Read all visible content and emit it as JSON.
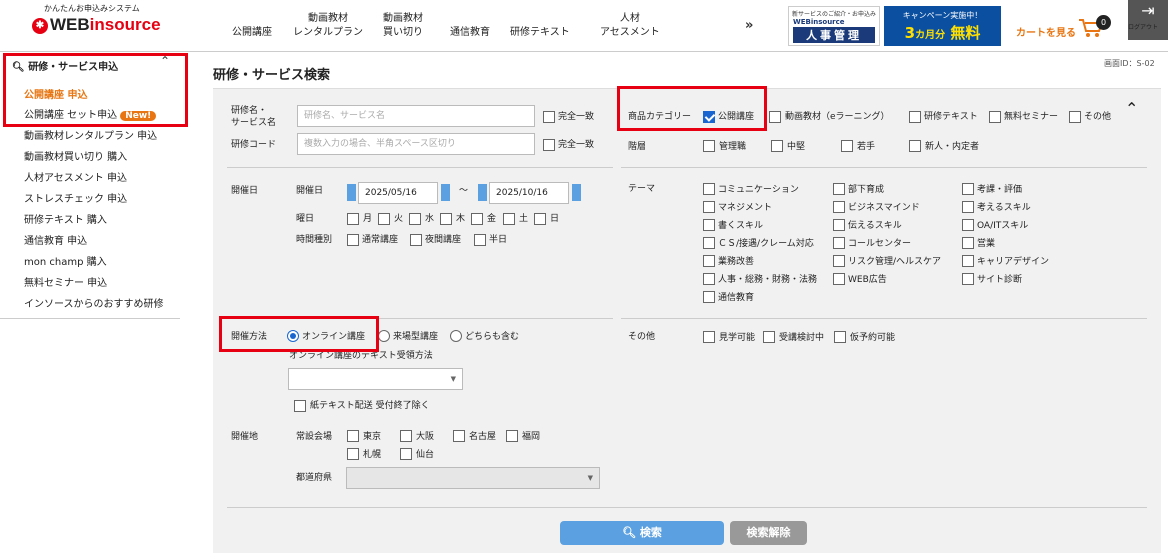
{
  "header": {
    "logo_tagline": "かんたんお申込みシステム",
    "logo_prefix": "WEB",
    "logo_suffix": "insource",
    "nav": [
      {
        "line1": "公開講座",
        "line2": ""
      },
      {
        "line1": "動画教材",
        "line2": "レンタルプラン"
      },
      {
        "line1": "動画教材",
        "line2": "買い切り"
      },
      {
        "line1": "通信教育",
        "line2": ""
      },
      {
        "line1": "研修テキスト",
        "line2": ""
      },
      {
        "line1": "人材",
        "line2": "アセスメント"
      }
    ],
    "more": "»",
    "promo1": {
      "top": "新サービスのご紹介・お申込み",
      "brand": "WEBinsource",
      "main": "人事管理"
    },
    "promo2": {
      "top": "キャンペーン実施中！",
      "main": "3",
      "unit": "カ月分",
      "tail": "無料"
    },
    "cart_label": "カートを見る",
    "cart_count": "0",
    "logout_label": "ログアウト"
  },
  "sidebar": {
    "heading": "研修・サービス申込",
    "items": [
      {
        "label": "公開講座 申込",
        "active": true
      },
      {
        "label": "公開講座 セット申込",
        "badge": "New!"
      },
      {
        "label": "動画教材レンタルプラン 申込"
      },
      {
        "label": "動画教材買い切り 購入"
      },
      {
        "label": "人材アセスメント 申込"
      },
      {
        "label": "ストレスチェック 申込"
      },
      {
        "label": "研修テキスト 購入"
      },
      {
        "label": "通信教育 申込"
      },
      {
        "label": "mon champ 購入"
      },
      {
        "label": "無料セミナー 申込"
      },
      {
        "label": "インソースからのおすすめ研修"
      }
    ]
  },
  "page": {
    "title": "研修・サービス検索",
    "screen_id": "画面ID：S-02"
  },
  "form": {
    "name_label_1": "研修名・",
    "name_label_2": "サービス名",
    "name_placeholder": "研修名、サービス名",
    "exact_label": "完全一致",
    "code_label": "研修コード",
    "code_placeholder": "複数入力の場合、半角スペース区切り",
    "date_section": "開催日",
    "date_label": "開催日",
    "date_from": "2025/05/16",
    "date_tilde": "〜",
    "date_to": "2025/10/16",
    "weekday_label": "曜日",
    "weekdays": [
      "月",
      "火",
      "水",
      "木",
      "金",
      "土",
      "日"
    ],
    "time_label": "時間種別",
    "time_types": [
      "通常講座",
      "夜間講座",
      "半日"
    ],
    "method_label": "開催方法",
    "methods": [
      {
        "label": "オンライン講座",
        "selected": true
      },
      {
        "label": "来場型講座",
        "selected": false
      },
      {
        "label": "どちらも含む",
        "selected": false
      }
    ],
    "text_receipt_label": "オンライン講座のテキスト受領方法",
    "paper_text_label": "紙テキスト配送 受付終了除く",
    "venue_label": "開催地",
    "permanent_venue_label": "常設会場",
    "venues": [
      "東京",
      "大阪",
      "名古屋",
      "福岡",
      "札幌",
      "仙台"
    ],
    "prefecture_label": "都道府県",
    "category_label": "商品カテゴリー",
    "categories": [
      {
        "label": "公開講座",
        "checked": true
      },
      {
        "label": "動画教材（eラーニング）",
        "checked": false
      },
      {
        "label": "研修テキスト",
        "checked": false
      },
      {
        "label": "無料セミナー",
        "checked": false
      },
      {
        "label": "その他",
        "checked": false
      }
    ],
    "level_label": "階層",
    "levels": [
      "管理職",
      "中堅",
      "若手",
      "新人・内定者"
    ],
    "theme_label": "テーマ",
    "themes": [
      [
        "コミュニケーション",
        "マネジメント",
        "書くスキル",
        "ＣＳ/接遇/クレーム対応",
        "業務改善",
        "人事・総務・財務・法務",
        "通信教育"
      ],
      [
        "部下育成",
        "ビジネスマインド",
        "伝えるスキル",
        "コールセンター",
        "リスク管理/ヘルスケア",
        "WEB広告"
      ],
      [
        "考課・評価",
        "考えるスキル",
        "OA/ITスキル",
        "営業",
        "キャリアデザイン",
        "サイト診断"
      ]
    ],
    "other_label": "その他",
    "others": [
      "見学可能",
      "受講検討中",
      "仮予約可能"
    ],
    "search_button": "検索",
    "clear_button": "検索解除"
  },
  "colors": {
    "accent_orange": "#e87511",
    "highlight_red": "#e60012",
    "primary_blue": "#5ba0e0",
    "nav_blue": "#0b4fa0"
  }
}
